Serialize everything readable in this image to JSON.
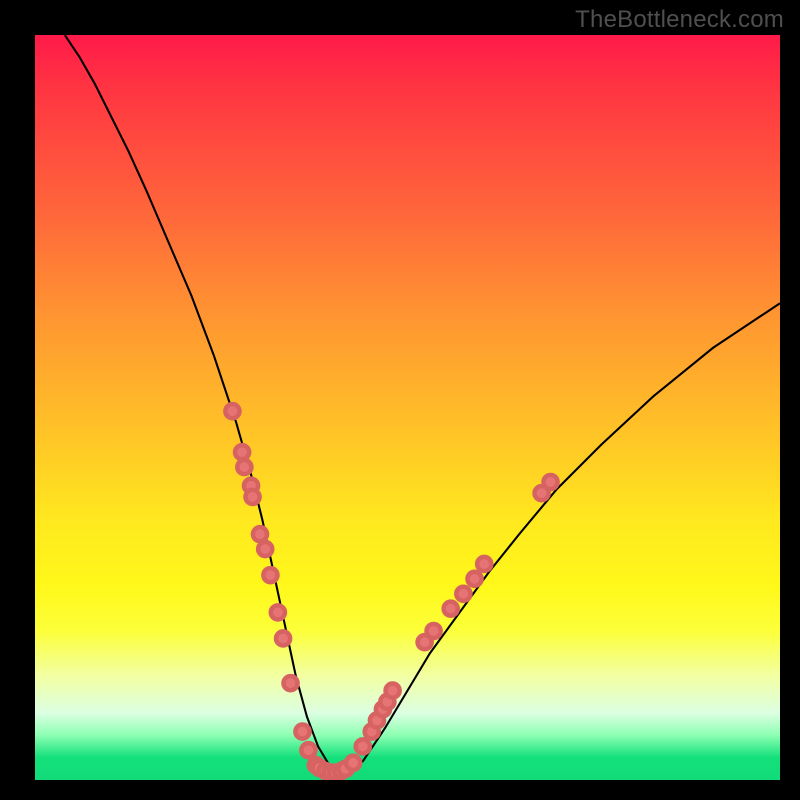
{
  "watermark": "TheBottleneck.com",
  "chart_data": {
    "type": "line",
    "title": "",
    "xlabel": "",
    "ylabel": "",
    "xlim": [
      0,
      100
    ],
    "ylim": [
      0,
      100
    ],
    "series": [
      {
        "name": "bottleneck-curve",
        "x": [
          4,
          6,
          8,
          10,
          12.5,
          15,
          18,
          21,
          24,
          27,
          29,
          30.5,
          32,
          33.5,
          35,
          36.5,
          38,
          39.5,
          41,
          44,
          47,
          50,
          53,
          57,
          61,
          65,
          70,
          76,
          83,
          91,
          100
        ],
        "y": [
          100,
          97,
          93.5,
          89.5,
          84.5,
          79,
          72,
          65,
          57,
          48,
          41,
          35,
          28,
          21,
          14,
          8.5,
          4.5,
          2,
          1,
          2.5,
          7,
          12,
          17,
          22.5,
          28,
          33,
          39,
          45,
          51.5,
          58,
          64
        ]
      }
    ],
    "scatter_points": {
      "name": "highlighted-points",
      "color": "#e77474",
      "points": [
        {
          "x": 26.5,
          "y": 49.5
        },
        {
          "x": 27.8,
          "y": 44
        },
        {
          "x": 28.1,
          "y": 42
        },
        {
          "x": 29,
          "y": 39.5
        },
        {
          "x": 29.2,
          "y": 38
        },
        {
          "x": 30.2,
          "y": 33
        },
        {
          "x": 30.9,
          "y": 31
        },
        {
          "x": 31.6,
          "y": 27.5
        },
        {
          "x": 32.6,
          "y": 22.5
        },
        {
          "x": 33.3,
          "y": 19
        },
        {
          "x": 34.3,
          "y": 13
        },
        {
          "x": 35.9,
          "y": 6.5
        },
        {
          "x": 36.7,
          "y": 4
        },
        {
          "x": 37.7,
          "y": 2
        },
        {
          "x": 38.2,
          "y": 1.6
        },
        {
          "x": 39,
          "y": 1.2
        },
        {
          "x": 39.7,
          "y": 1.0
        },
        {
          "x": 40.4,
          "y": 1.0
        },
        {
          "x": 41.1,
          "y": 1.2
        },
        {
          "x": 41.7,
          "y": 1.5
        },
        {
          "x": 42.7,
          "y": 2.3
        },
        {
          "x": 44,
          "y": 4.5
        },
        {
          "x": 45.2,
          "y": 6.5
        },
        {
          "x": 45.9,
          "y": 8
        },
        {
          "x": 46.7,
          "y": 9.5
        },
        {
          "x": 47.3,
          "y": 10.5
        },
        {
          "x": 48,
          "y": 12
        },
        {
          "x": 52.3,
          "y": 18.5
        },
        {
          "x": 53.5,
          "y": 20
        },
        {
          "x": 55.8,
          "y": 23
        },
        {
          "x": 57.5,
          "y": 25
        },
        {
          "x": 59,
          "y": 27
        },
        {
          "x": 60.3,
          "y": 29
        },
        {
          "x": 68,
          "y": 38.5
        },
        {
          "x": 69.2,
          "y": 40
        }
      ]
    }
  }
}
